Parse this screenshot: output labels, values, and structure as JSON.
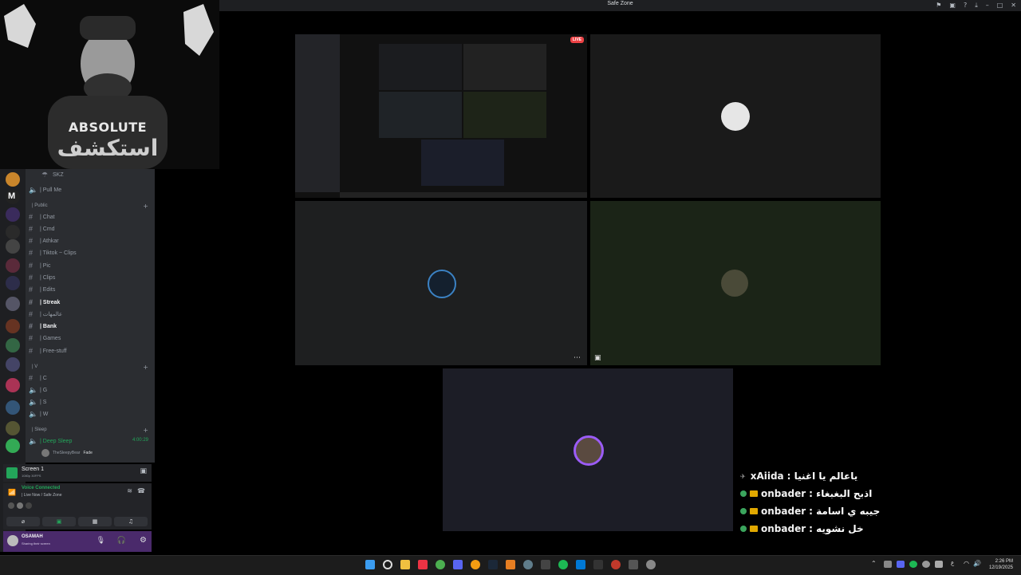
{
  "window": {
    "title": "Safe Zone"
  },
  "webcam": {
    "brand_en": "ABSOLUTE",
    "brand_ar": "استكشف"
  },
  "channels": {
    "top": [
      {
        "label": "SKZ"
      },
      {
        "label": "| Pull Me"
      }
    ],
    "public_category": "| Public",
    "public": [
      {
        "label": "| Chat"
      },
      {
        "label": "| Cmd"
      },
      {
        "label": "| Athkar"
      },
      {
        "label": "| Tiktok ~ Clips"
      },
      {
        "label": "| Pic"
      },
      {
        "label": "| Clips"
      },
      {
        "label": "| Edits"
      },
      {
        "label": "| Streak"
      },
      {
        "label": "| عالمهات"
      },
      {
        "label": "| Bank"
      },
      {
        "label": "| Games"
      },
      {
        "label": "| Free-stuff"
      }
    ],
    "v_category": "| V",
    "v": [
      {
        "label": "| C"
      },
      {
        "label": "| G"
      },
      {
        "label": "| S"
      },
      {
        "label": "| W"
      }
    ],
    "sleep_category": "| Sleep",
    "sleep": {
      "label": "| Deep Sleep",
      "timer": "4:00:29",
      "member": "TheSleepyBear",
      "member_tag": "Fade"
    }
  },
  "stream_panel": {
    "title": "Screen 1",
    "subtitle": "1080p 30FPS"
  },
  "voice_panel": {
    "status": "Voice Connected",
    "location": "| Live Now / Safe Zone"
  },
  "user_panel": {
    "name": "OSAMAH",
    "status": "Sharing their screen"
  },
  "chat": [
    {
      "name": "xAiida",
      "message": "ياعالم يا اغنيا"
    },
    {
      "name": "onbader",
      "message": "اذبح البغبغاء"
    },
    {
      "name": "onbader",
      "message": "جيبه ي اسامة"
    },
    {
      "name": "onbader",
      "message": "خل نشويه"
    }
  ],
  "tiles": {
    "live_badge": "LIVE"
  },
  "clock": {
    "time": "2:26 PM",
    "date": "12/19/2025"
  },
  "taskbar": {
    "lang": "ع"
  }
}
